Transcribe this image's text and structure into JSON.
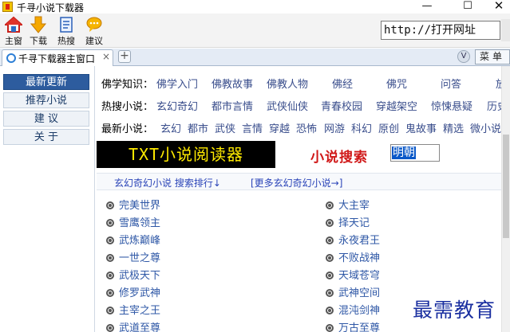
{
  "window": {
    "title": "千寻小说下载器",
    "minimize": "—",
    "maximize": "☐",
    "close": "✕"
  },
  "toolbar": {
    "items": [
      {
        "label": "主窗",
        "icon": "home-icon"
      },
      {
        "label": "下载",
        "icon": "download-arrow-icon"
      },
      {
        "label": "热搜",
        "icon": "notepad-icon"
      },
      {
        "label": "建议",
        "icon": "chat-bubble-icon"
      }
    ],
    "address_value": "http://打开网址"
  },
  "tabs": {
    "active_tab": "千寻下载器主窗口",
    "close": "×",
    "new_tab": "+",
    "v_button": "V",
    "menu_label": "菜单"
  },
  "sidebar": {
    "items": [
      "最新更新",
      "推荐小说",
      "建  议",
      "关  于"
    ]
  },
  "main": {
    "rows": [
      {
        "label": "佛学知识：",
        "links": [
          "佛学入门",
          "佛教故事",
          "佛教人物",
          "佛经",
          "佛咒",
          "问答",
          "放"
        ]
      },
      {
        "label": "热搜小说：",
        "links": [
          "玄幻奇幻",
          "都市言情",
          "武侠仙侠",
          "青春校园",
          "穿越架空",
          "惊悚悬疑",
          "历史"
        ]
      },
      {
        "label": "最新小说：",
        "links": [
          "玄幻",
          "都市",
          "武侠",
          "言情",
          "穿越",
          "恐怖",
          "网游",
          "科幻",
          "原创",
          "鬼故事",
          "精选",
          "微小说"
        ]
      }
    ],
    "banner_text": "TXT小说阅读器",
    "search_label": "小说搜索",
    "search_value": "明朝",
    "subnav_ranking": "玄幻奇幻小说 搜索排行↓",
    "subnav_more": "[更多玄幻奇幻小说→]",
    "novels_left": [
      "完美世界",
      "雪鹰领主",
      "武炼巅峰",
      "一世之尊",
      "武极天下",
      "修罗武神",
      "主宰之王",
      "武道至尊"
    ],
    "novels_right": [
      "大主宰",
      "择天记",
      "永夜君王",
      "不败战神",
      "天域苍穹",
      "武神空间",
      "混沌剑神",
      "万古至尊"
    ]
  },
  "watermark": "最需教育"
}
